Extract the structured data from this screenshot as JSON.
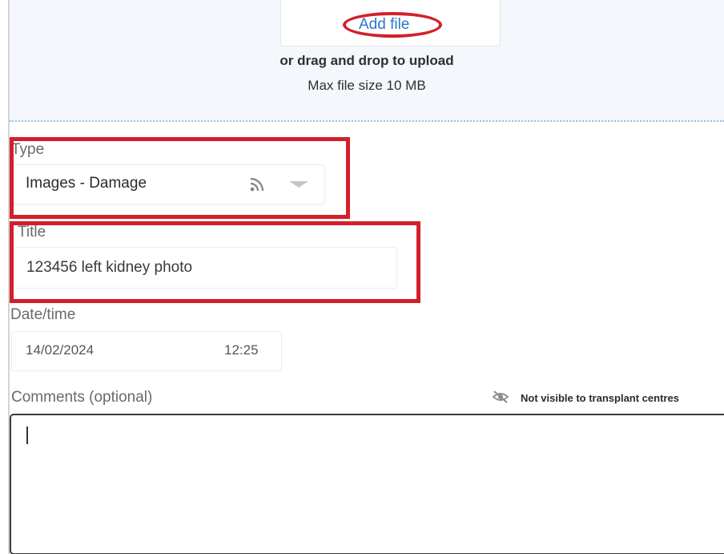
{
  "upload": {
    "add_file_label": "Add file",
    "drag_drop_text": "or drag and drop to upload",
    "max_size_text": "Max file size 10 MB"
  },
  "type_field": {
    "label": "Type",
    "selected_value": "Images - Damage",
    "icon": "feed-icon"
  },
  "title_field": {
    "label": "Title",
    "value": "123456 left kidney photo"
  },
  "datetime_field": {
    "label": "Date/time",
    "date": "14/02/2024",
    "time": "12:25"
  },
  "comments_field": {
    "label": "Comments (optional)",
    "value": "",
    "visibility_note": "Not visible to transplant centres",
    "visibility_icon": "eye-off-icon"
  },
  "colors": {
    "highlight": "#d2202b",
    "link": "#2a77c9",
    "upload_zone_bg": "#f4f7fb"
  }
}
